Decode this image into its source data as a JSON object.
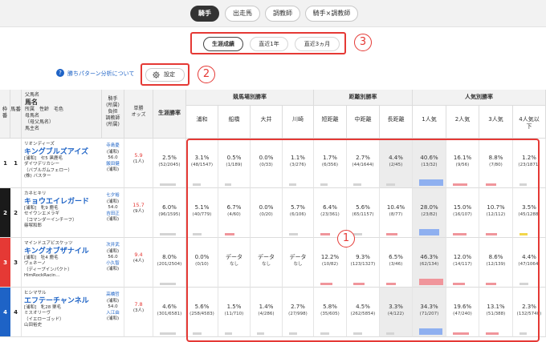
{
  "tabs": {
    "jockey": "騎手",
    "horse": "出走馬",
    "trainer": "調教師",
    "jockey_trainer": "騎手×調教師"
  },
  "ranges": {
    "career": "生涯成績",
    "last1y": "直近1年",
    "last3m": "直近3ヵ月"
  },
  "markers": {
    "m1": "1",
    "m2": "2",
    "m3": "3"
  },
  "help_link": "勝ちパターン分析について",
  "help_icon_text": "?",
  "settings_button": "設定",
  "header": {
    "waku": "枠番",
    "umaban": "馬番",
    "horse_col": [
      "父馬名",
      "馬名",
      "所属　性齢　毛色",
      "母馬名",
      "（母父馬名）",
      "馬主名"
    ],
    "jockey_col": [
      "騎手",
      "(所属)",
      "負担",
      "調教師",
      "(所属)"
    ],
    "odds": [
      "単勝",
      "オッズ"
    ],
    "career": "生涯勝率",
    "venue_group": "競馬場別勝率",
    "venues": [
      "浦和",
      "船橋",
      "大井",
      "川崎"
    ],
    "distance_group": "距離別勝率",
    "distances": [
      "短距離",
      "中距離",
      "長距離"
    ],
    "pop_group": "人気別勝率",
    "pops": [
      "1人気",
      "2人気",
      "3人気",
      "4人気以下"
    ]
  },
  "colors": {
    "accent": "#e53935",
    "link": "#1e63c6",
    "bar_blue": "#8fb0f0",
    "bar_red": "#f0959b",
    "bar_yellow": "#f2d64a",
    "bar_gray": "#d4d4d4"
  },
  "rows": [
    {
      "waku": "1",
      "umaban": "1",
      "waku_color": "#ffffff",
      "waku_text": "#222",
      "sire": "リオンディーズ",
      "name": "キングブルズアイズ",
      "info": "[浦和]　セ5 黒鹿毛",
      "dam": "ダイワデリカシー",
      "damsire": "（バブルガムフェロー）",
      "owner": "(株) バスター",
      "jockey": "寺島憂",
      "jockey_aff": "(浦和)",
      "weight": "56.0",
      "trainer": "飯田健",
      "trainer_aff": "(浦和)",
      "odds": "5.9",
      "pop": "(1人)",
      "career": [
        "2.5%",
        "(52/2045)"
      ],
      "venues": [
        [
          "3.1%",
          "(48/1547)"
        ],
        [
          "0.5%",
          "(1/189)"
        ],
        [
          "0.0%",
          "(0/33)"
        ],
        [
          "1.1%",
          "(3/276)"
        ]
      ],
      "distances": [
        [
          "1.7%",
          "(6/356)"
        ],
        [
          "2.7%",
          "(44/1644)"
        ],
        [
          "4.4%",
          "(2/45)"
        ]
      ],
      "pops": [
        [
          "40.6%",
          "(13/32)"
        ],
        [
          "16.1%",
          "(9/56)"
        ],
        [
          "8.8%",
          "(7/80)"
        ],
        [
          "1.2%",
          "(23/1871)"
        ]
      ]
    },
    {
      "waku": "2",
      "umaban": "2",
      "waku_color": "#1a1a1a",
      "waku_text": "#fff",
      "sire": "カネヒキリ",
      "name": "キョウエイレガード",
      "info": "[浦和]　牝9 鹿毛",
      "dam": "セイウンエメラギ",
      "damsire": "（コマンダーインチーフ）",
      "owner": "篠塚和郎",
      "jockey": "七夕裕",
      "jockey_aff": "(浦和)",
      "weight": "54.0",
      "trainer": "吉田正",
      "trainer_aff": "(浦和)",
      "odds": "15.7",
      "pop": "(9人)",
      "career": [
        "6.0%",
        "(96/1595)"
      ],
      "venues": [
        [
          "5.1%",
          "(40/779)"
        ],
        [
          "6.7%",
          "(4/60)"
        ],
        [
          "0.0%",
          "(0/20)"
        ],
        [
          "5.7%",
          "(6/106)"
        ]
      ],
      "distances": [
        [
          "6.4%",
          "(23/361)"
        ],
        [
          "5.6%",
          "(65/1157)"
        ],
        [
          "10.4%",
          "(8/77)"
        ]
      ],
      "pops": [
        [
          "28.0%",
          "(23/82)"
        ],
        [
          "15.0%",
          "(16/107)"
        ],
        [
          "10.7%",
          "(12/112)"
        ],
        [
          "3.5%",
          "(45/1288)"
        ]
      ]
    },
    {
      "waku": "3",
      "umaban": "3",
      "waku_color": "#e53935",
      "waku_text": "#fff",
      "sire": "マインドユアビスケッツ",
      "name": "キングオブザナイル",
      "info": "[浦和]　牡4 鹿毛",
      "dam": "ヴェネーノ",
      "damsire": "（ディープインパクト）",
      "owner": "HimRockRacin…",
      "jockey": "次井武",
      "jockey_aff": "(浦和)",
      "weight": "56.0",
      "trainer": "小久智",
      "trainer_aff": "(浦和)",
      "odds": "9.4",
      "pop": "(4人)",
      "career": [
        "8.0%",
        "(201/2504)"
      ],
      "venues": [
        [
          "0.0%",
          "(0/10)"
        ],
        [
          "データ",
          "なし"
        ],
        [
          "データ",
          "なし"
        ],
        [
          "データ",
          "なし"
        ]
      ],
      "distances": [
        [
          "12.2%",
          "(10/82)"
        ],
        [
          "9.3%",
          "(123/1327)"
        ],
        [
          "6.5%",
          "(3/46)"
        ]
      ],
      "pops": [
        [
          "46.3%",
          "(62/134)"
        ],
        [
          "12.0%",
          "(14/117)"
        ],
        [
          "8.6%",
          "(12/139)"
        ],
        [
          "4.4%",
          "(47/1064)"
        ]
      ]
    },
    {
      "waku": "4",
      "umaban": "4",
      "waku_color": "#1e63c6",
      "waku_text": "#fff",
      "sire": "ヒシマサル",
      "name": "エフテーチャンネル",
      "info": "[浦和]　牝28 栗毛",
      "dam": "ミスオリーヴ",
      "damsire": "（イエローゴッド）",
      "owner": "山田裕史",
      "jockey": "高橋哲",
      "jockey_aff": "(浦和)",
      "weight": "54.0",
      "trainer": "入江由",
      "trainer_aff": "(浦和)",
      "odds": "7.8",
      "pop": "(3人)",
      "career": [
        "4.6%",
        "(301/6581)"
      ],
      "venues": [
        [
          "5.6%",
          "(258/4583)"
        ],
        [
          "1.5%",
          "(11/710)"
        ],
        [
          "1.4%",
          "(4/286)"
        ],
        [
          "2.7%",
          "(27/998)"
        ]
      ],
      "distances": [
        [
          "5.8%",
          "(35/605)"
        ],
        [
          "4.5%",
          "(262/5854)"
        ],
        [
          "3.3%",
          "(4/122)"
        ]
      ],
      "pops": [
        [
          "34.3%",
          "(71/207)"
        ],
        [
          "19.6%",
          "(47/240)"
        ],
        [
          "13.1%",
          "(51/388)"
        ],
        [
          "2.3%",
          "(132/5740)"
        ]
      ]
    }
  ]
}
